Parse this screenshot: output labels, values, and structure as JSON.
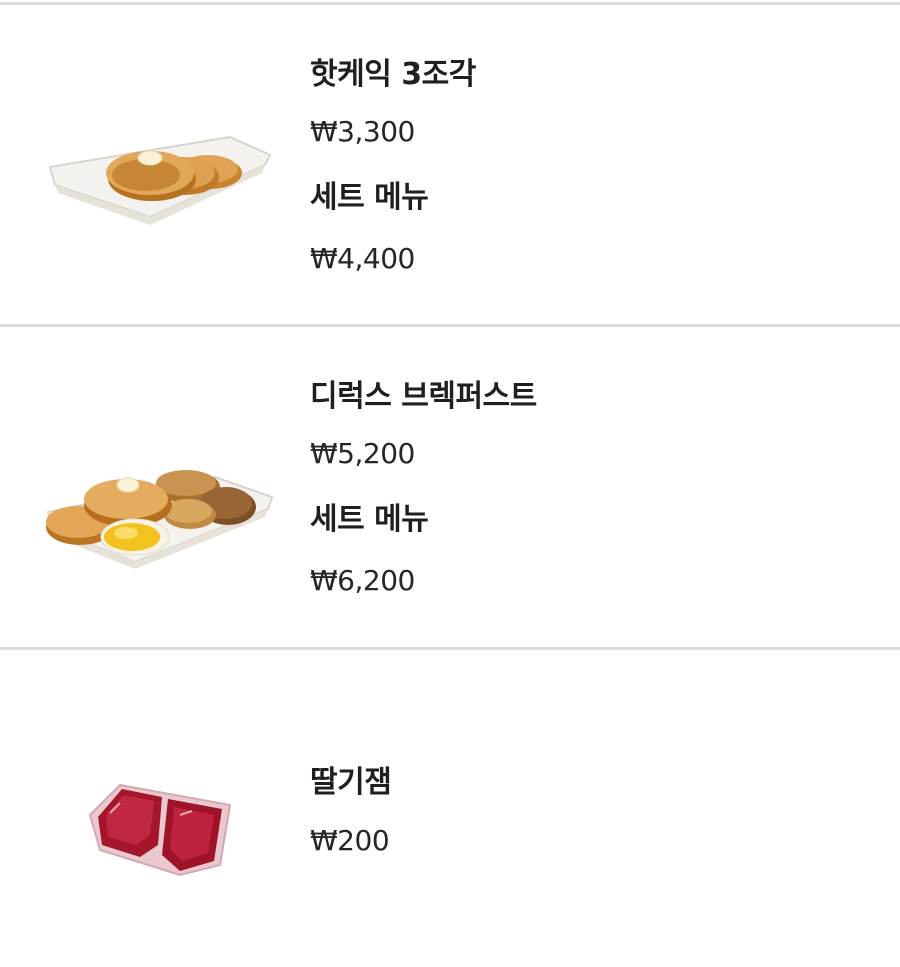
{
  "menu_items": [
    {
      "name": "핫케익 3조각",
      "price": "₩3,300",
      "set_label": "세트 메뉴",
      "set_price": "₩4,400",
      "image_icon": "hotcakes-tray-image"
    },
    {
      "name": "디럭스 브렉퍼스트",
      "price": "₩5,200",
      "set_label": "세트 메뉴",
      "set_price": "₩6,200",
      "image_icon": "deluxe-breakfast-tray-image"
    },
    {
      "name": "딸기잼",
      "price": "₩200",
      "image_icon": "strawberry-jam-cup-image"
    }
  ],
  "colors": {
    "divider": "#dcdcdc",
    "text": "#1f1f1f",
    "jam": "#a3162c",
    "pancake": "#d9953d",
    "tray": "#f3f1ec"
  }
}
